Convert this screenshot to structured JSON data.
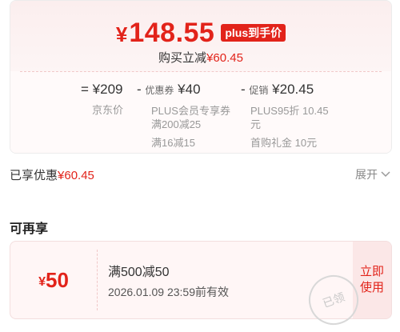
{
  "price_card": {
    "currency": "¥",
    "final_price": "148.55",
    "badge": "plus到手价",
    "save_prefix": "购买立减",
    "save_amount": "¥60.45",
    "breakdown": {
      "equals": "=",
      "base_price": "¥209",
      "base_label": "京东价",
      "coupon_sign": "-",
      "coupon_title": "优惠券",
      "coupon_value": "¥40",
      "coupon_line1": "PLUS会员专享券",
      "coupon_line2": "满200减25",
      "coupon_line3": "满16减15",
      "promo_sign": "-",
      "promo_title": "促销",
      "promo_value": "¥20.45",
      "promo_line1": "PLUS95折 10.45",
      "promo_line2": "元",
      "promo_line3": "首购礼金 10元"
    }
  },
  "discount_summary": {
    "label": "已享优惠",
    "amount": "¥60.45",
    "expand_label": "展开"
  },
  "more_offers": {
    "section_title": "可再享",
    "coupon": {
      "currency": "¥",
      "amount": "50",
      "title": "满500减50",
      "expiry": "2026.01.09 23:59前有效",
      "action_line1": "立即",
      "action_line2": "使用",
      "stamp_text": "已领"
    }
  },
  "colors": {
    "accent": "#e2231a",
    "muted": "#999999",
    "card_bg": "#fbeeee"
  },
  "icons": {
    "expand": "chevron-down-icon"
  }
}
